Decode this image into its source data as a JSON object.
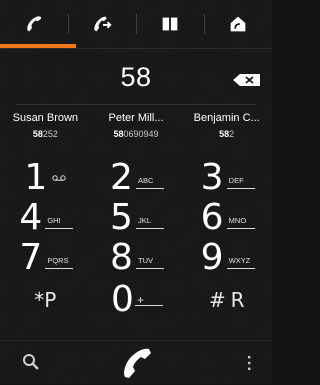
{
  "tabs": [
    {
      "icon": "phone-icon",
      "active": true
    },
    {
      "icon": "call-log-icon",
      "active": false
    },
    {
      "icon": "contacts-book-icon",
      "active": false
    },
    {
      "icon": "favorite-home-icon",
      "active": false
    }
  ],
  "accent_color": "#f07a1b",
  "dialed_number": "58",
  "suggestions": [
    {
      "name": "Susan Brown",
      "match": "58",
      "rest": "252"
    },
    {
      "name": "Peter Mill...",
      "match": "58",
      "rest": "0690949"
    },
    {
      "name": "Benjamin C...",
      "match": "58",
      "rest": "2"
    }
  ],
  "keys": [
    {
      "digit": "1",
      "letters": ""
    },
    {
      "digit": "2",
      "letters": "ABC"
    },
    {
      "digit": "3",
      "letters": "DEF"
    },
    {
      "digit": "4",
      "letters": "GHI"
    },
    {
      "digit": "5",
      "letters": "JKL"
    },
    {
      "digit": "6",
      "letters": "MNO"
    },
    {
      "digit": "7",
      "letters": "PQRS"
    },
    {
      "digit": "8",
      "letters": "TUV"
    },
    {
      "digit": "9",
      "letters": "WXYZ"
    },
    {
      "digit": "*",
      "letters": "P"
    },
    {
      "digit": "0",
      "letters": "+"
    },
    {
      "digit": "#",
      "letters": "R"
    }
  ]
}
